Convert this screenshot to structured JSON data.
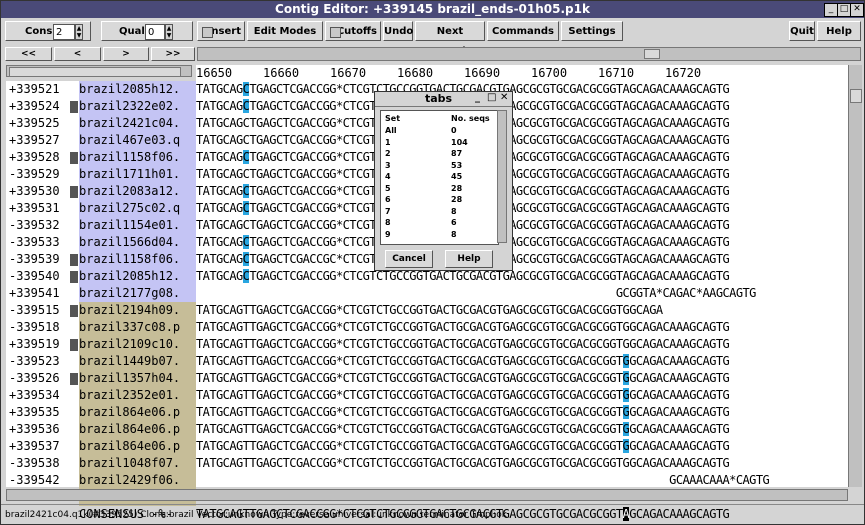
{
  "window": {
    "title": "Contig Editor: +339145 brazil_ends-01h05.p1k"
  },
  "toolbar": {
    "cons_label": "Cons",
    "cons_value": "2",
    "qual_label": "Qual",
    "qual_value": "0",
    "insert": "Insert",
    "edit_modes": "Edit Modes >>",
    "cutoffs": "Cutoffs",
    "undo": "Undo",
    "next_search": "Next Search",
    "commands": "Commands >>",
    "settings": "Settings >>",
    "quit": "Quit",
    "help": "Help >>"
  },
  "nav": {
    "first": "<<",
    "prev": "<",
    "next": ">",
    "last": ">>"
  },
  "ruler": [
    "16650",
    "16660",
    "16670",
    "16680",
    "16690",
    "16700",
    "16710",
    "16720"
  ],
  "reads": [
    {
      "num": "+339521",
      "name": "brazil2085h12.",
      "seq": "TATGCAGCTGAGCTCGACCGG*CTCGTCTGCCGGTGACTGCGACGTGAGCGCGTGCGACGCGGTAGCAGACAAAGCAGTG",
      "group": 1,
      "mark": false
    },
    {
      "num": "+339524",
      "name": "brazil2322e02.",
      "seq": "TATGCAGCTGAGCTCGACCGG*CTCGTCTGCCGGTGACTGCGACGTGAGCGCGTGCGACGCGGTAGCAGACAAAGCAGTG",
      "group": 1,
      "mark": true
    },
    {
      "num": "+339525",
      "name": "brazil2421c04.",
      "seq": "TATGCAGCTGAGCTCGACCGG*CTCGTCTGCCGGTGACTGCGACGTGAGCGCGTGCGACGCGGTAGCAGACAAAGCAGTG",
      "group": 1,
      "mark": false
    },
    {
      "num": "+339527",
      "name": "brazil467e03.q",
      "seq": "TATGCAGCTGAGCTCGACCGG*CTCGTCTGCCGGTGACTGCGACGTGAGCGCGTGCGACGCGGTAGCAGACAAAGCAGTG",
      "group": 1,
      "mark": false
    },
    {
      "num": "+339528",
      "name": "brazil1158f06.",
      "seq": "TATGCAGCTGAGCTCGACCGG*CTCGTCTGCCGGTGACTGCGACGTGAGCGCGTGCGACGCGGTAGCAGACAAAGCAGTG",
      "group": 1,
      "mark": true
    },
    {
      "num": "-339529",
      "name": "brazil1711h01.",
      "seq": "TATGCAGCTGAGCTCGACCGG*CTCGTCTGCCGGTGACTGCGACGTGAGCGCGTGCGACGCGGTAGCAGACAAAGCAGTG",
      "group": 1,
      "mark": false
    },
    {
      "num": "+339530",
      "name": "brazil2083a12.",
      "seq": "TATGCAGCTGAGCTCGACCGG*CTCGTCTGCCGGTGACTGCGACGTGAGCGCGTGCGACGCGGTAGCAGACAAAGCAGTG",
      "group": 1,
      "mark": true
    },
    {
      "num": "+339531",
      "name": "brazil275c02.q",
      "seq": "TATGCAGCTGAGCTCGACCGG*CTCGTCTGCCGGTGACTGCGACGTGAGCGCGTGCGACGCGGTAGCAGACAAAGCAGTG",
      "group": 1,
      "mark": false
    },
    {
      "num": "-339532",
      "name": "brazil1154e01.",
      "seq": "TATGCAGCTGAGCTCGACCGG*CTCGTCTGCCGGTGACTGCGACGTGAGCGCGTGCGACGCGGTAGCAGACAAAGCAGTG",
      "group": 1,
      "mark": false
    },
    {
      "num": "-339533",
      "name": "brazil1566d04.",
      "seq": "TATGCAGCTGAGCTCGACCGG*CTCGTCTGCCGGTGACTGCGACGTGAGCGCGTGCGACGCGGTAGCAGACAAAGCAGTG",
      "group": 1,
      "mark": false
    },
    {
      "num": "-339539",
      "name": "brazil1158f06.",
      "seq": "TATGCAGCTGAGCTCGACCGC*CTCGTCTGCCGGTGACTGCGACGTGAGCGCGTGCGACGCGGTAGCAGACAAAGCAGTG",
      "group": 1,
      "mark": true
    },
    {
      "num": "-339540",
      "name": "brazil2085h12.",
      "seq": "TATGCAGCTGAGCTCGACCGG*CTCGTCTGCCGGTGACTGCGACGTGAGCGCGTGCGACGCGGTAGCAGACAAAGCAGTG",
      "group": 1,
      "mark": true
    },
    {
      "num": "+339541",
      "name": "brazil2177g08.",
      "seq": "                                                               GCGGTA*CAGAC*AAGCAGTG",
      "group": 1,
      "mark": false
    },
    {
      "num": "-339515",
      "name": "brazil2194h09.",
      "seq": "TATGCAGTTGAGCTCGACCGG*CTCGTCTGCCGGTGACTGCGACGTGAGCGCGTGCGACGCGGTGGCAGA",
      "group": 2,
      "mark": true
    },
    {
      "num": "-339518",
      "name": "brazil337c08.p",
      "seq": "TATGCAGTTGAGCTCGACCGG*CTCGTCTGCCGGTGACTGCGACGTGAGCGCGTGCGACGCGGTGGCAGACAAAGCAGTG",
      "group": 2,
      "mark": false
    },
    {
      "num": "+339519",
      "name": "brazil2109c10.",
      "seq": "TATGCAGTTGAGCTCGACCGG*CTCGTCTGCCGGTGACTGCGACGTGAGCGCGTGCGACGCGGTGGCAGACAAAGCAGTG",
      "group": 2,
      "mark": true
    },
    {
      "num": "-339523",
      "name": "brazil1449b07.",
      "seq": "TATGCAGTTGAGCTCGACCGG*CTCGTCTGCCGGTGACTGCGACGTGAGCGCGTGCGACGCGGTGGCAGACAAAGCAGTG",
      "group": 2,
      "mark": false
    },
    {
      "num": "-339526",
      "name": "brazil1357h04.",
      "seq": "TATGCAGTTGAGCTCGACCGG*CTCGTCTGCCGGTGACTGCGACGTGAGCGCGTGCGACGCGGTGGCAGACAAAGCAGTG",
      "group": 2,
      "mark": true
    },
    {
      "num": "+339534",
      "name": "brazil2352e01.",
      "seq": "TATGCAGTTGAGCTCGACCGG*CTCGTCTGCCGGTGACTGCGACGTGAGCGCGTGCGACGCGGTGGCAGACAAAGCAGTG",
      "group": 2,
      "mark": false
    },
    {
      "num": "+339535",
      "name": "brazil864e06.p",
      "seq": "TATGCAGTTGAGCTCGACCGG*CTCGTCTGCCGGTGACTGCGACGTGAGCGCGTGCGACGCGGTGGCAGACAAAGCAGTG",
      "group": 2,
      "mark": false
    },
    {
      "num": "+339536",
      "name": "brazil864e06.p",
      "seq": "TATGCAGTTGAGCTCGACCGG*CTCGTCTGCCGGTGACTGCGACGTGAGCGCGTGCGACGCGGTGGCAGACAAAGCAGTG",
      "group": 2,
      "mark": false
    },
    {
      "num": "+339537",
      "name": "brazil864e06.p",
      "seq": "TATGCAGTTGAGCTCGACCGG*CTCGTCTGCCGGTGACTGCGACGTGAGCGCGTGCGACGCGGTGGCAGACAAAGCAGTG",
      "group": 2,
      "mark": false
    },
    {
      "num": "-339538",
      "name": "brazil1048f07.",
      "seq": "TATGCAGTTGAGCTCGACCGG*CTCGTCTGCCGGTGACTGCGACGTGAGCGCGTGCGACGCGGTGGCAGACAAAGCAGTG",
      "group": 2,
      "mark": false
    },
    {
      "num": "-339542",
      "name": "brazil2429f06.",
      "seq": "                                                                       GCAAACAAA*CAGTG",
      "group": 2,
      "mark": false
    },
    {
      "num": "+339543",
      "name": "brazil1070d05.",
      "seq": "                                                                                     G",
      "group": 2,
      "mark": false
    }
  ],
  "consensus": {
    "label": "CONSENSUS -%-",
    "seq": "TATGCAGTTGAGCTCGACCGG*CTCGTCTGCCGGTGACTGCGACGTGAGCGCGTGCGACGCGGTAGCAGACAAAGCAGTG"
  },
  "dialog": {
    "title": "tabs",
    "col_set": "Set",
    "col_seqs": "No. seqs",
    "rows": [
      {
        "set": "All",
        "n": "0"
      },
      {
        "set": "1",
        "n": "104"
      },
      {
        "set": "2",
        "n": "87"
      },
      {
        "set": "3",
        "n": "53"
      },
      {
        "set": "4",
        "n": "45"
      },
      {
        "set": "5",
        "n": "28"
      },
      {
        "set": "6",
        "n": "28"
      },
      {
        "set": "7",
        "n": "8"
      },
      {
        "set": "8",
        "n": "6"
      },
      {
        "set": "9",
        "n": "8"
      }
    ],
    "cancel": "Cancel",
    "help": "Help"
  },
  "status": "brazil2421c04.q1k(#339525) Clone:brazil Vector:unknown Type:reverse universal:unknown terminator Tmpl:ok",
  "colors": {
    "highlight": "#29a6e0",
    "group1_name": "#c4c4f4",
    "group2_name": "#c6bd98",
    "title_bar": "#4a4a78"
  }
}
